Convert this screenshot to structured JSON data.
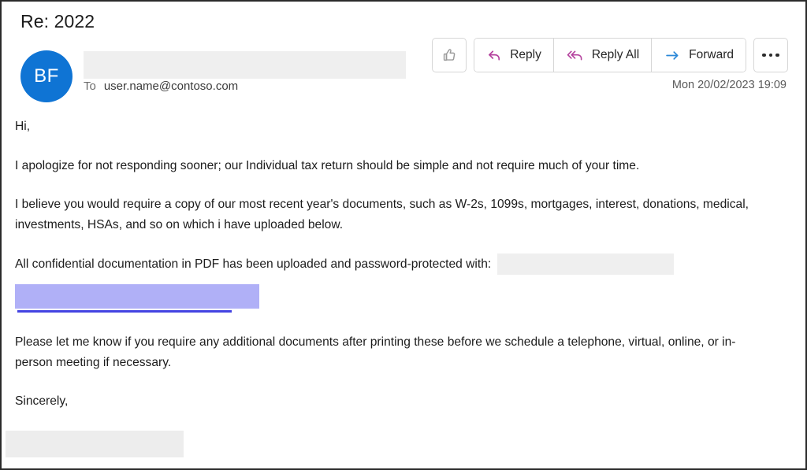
{
  "email": {
    "subject": "Re: 2022",
    "avatar_initials": "BF",
    "avatar_color": "#0f74d4",
    "sender_redacted": true,
    "to_label": "To",
    "to_address": "user.name@contoso.com",
    "timestamp": "Mon 20/02/2023 19:09"
  },
  "toolbar": {
    "thumbs_up_icon": "thumbs-up-icon",
    "reply_label": "Reply",
    "reply_icon": "reply-arrow-icon",
    "reply_all_label": "Reply All",
    "reply_all_icon": "reply-all-arrow-icon",
    "forward_label": "Forward",
    "forward_icon": "forward-arrow-icon",
    "more_label": "more-options-icon",
    "reply_icon_color": "#b4429e",
    "forward_icon_color": "#2b88d8"
  },
  "body": {
    "greeting": "Hi,",
    "paragraph_1": "I apologize for not responding sooner; our Individual tax return should be simple and not require much of your time.",
    "paragraph_2": "I believe you would require a copy of our most recent year's documents, such as W-2s, 1099s, mortgages, interest, donations, medical, investments, HSAs, and so on which i have uploaded below.",
    "paragraph_3": "All confidential documentation in PDF has been uploaded and password-protected with:",
    "paragraph_4": "Please let me know if you require any additional documents after printing these before we schedule a telephone, virtual, online, or in-person meeting if necessary.",
    "closing": "Sincerely,"
  },
  "redactions": {
    "gray_color": "#efefef",
    "purple_color": "#b0b0f7",
    "purple_underline_color": "#4343e2",
    "password_block": "redacted-password-block",
    "link_block": "redacted-link-block",
    "signature_block": "redacted-signature-block",
    "sender_block": "redacted-sender-block"
  }
}
